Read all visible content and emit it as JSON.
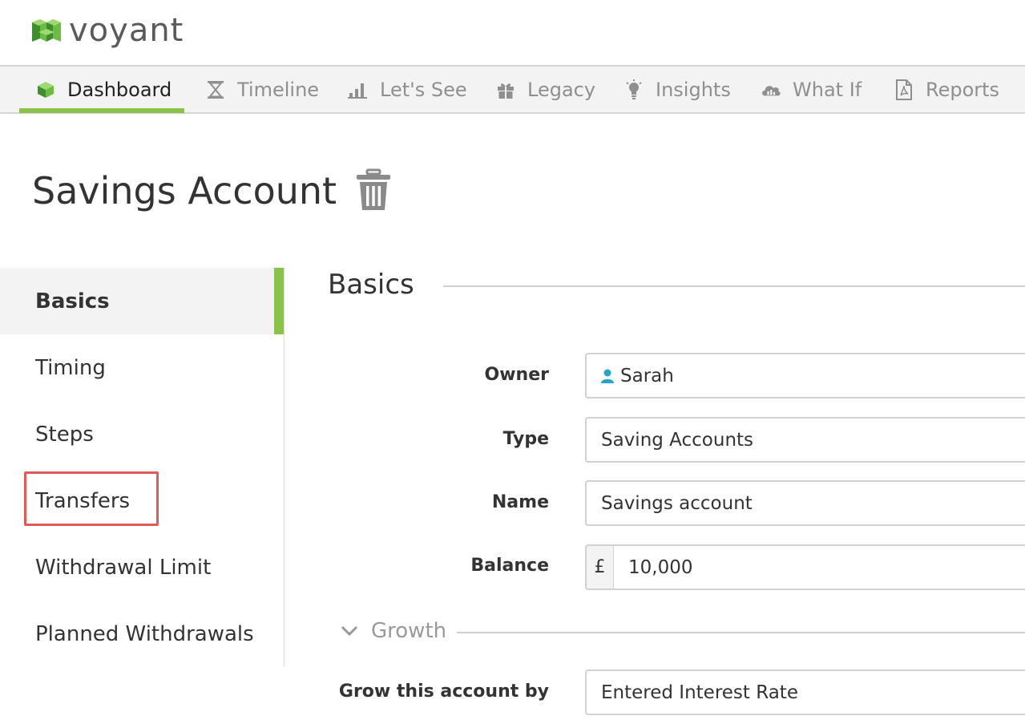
{
  "app": {
    "logo_text": "voyant",
    "brand_color": "#6dbb45"
  },
  "nav": {
    "tabs": [
      {
        "label": "Dashboard",
        "icon": "cube-icon",
        "active": true
      },
      {
        "label": "Timeline",
        "icon": "hourglass-icon"
      },
      {
        "label": "Let's See",
        "icon": "bar-chart-icon"
      },
      {
        "label": "Legacy",
        "icon": "gift-icon"
      },
      {
        "label": "Insights",
        "icon": "lightbulb-icon"
      },
      {
        "label": "What If",
        "icon": "cloud-chart-icon"
      },
      {
        "label": "Reports",
        "icon": "pdf-file-icon"
      }
    ]
  },
  "page": {
    "title": "Savings Account"
  },
  "side_menu": {
    "items": [
      {
        "label": "Basics",
        "active": true
      },
      {
        "label": "Timing"
      },
      {
        "label": "Steps"
      },
      {
        "label": "Transfers",
        "highlighted": true
      },
      {
        "label": "Withdrawal Limit"
      },
      {
        "label": "Planned Withdrawals"
      }
    ]
  },
  "section": {
    "title": "Basics"
  },
  "form": {
    "owner": {
      "label": "Owner",
      "value": "Sarah"
    },
    "type": {
      "label": "Type",
      "value": "Saving Accounts"
    },
    "name": {
      "label": "Name",
      "value": "Savings account"
    },
    "balance": {
      "label": "Balance",
      "prefix": "£",
      "value": "10,000"
    },
    "growth": {
      "label": "Growth"
    },
    "grow_by": {
      "label": "Grow this account by",
      "value": "Entered Interest Rate"
    }
  },
  "colors": {
    "accent": "#8bc34a",
    "highlight_box": "#e05a5a",
    "user_icon": "#2aa3c9"
  }
}
